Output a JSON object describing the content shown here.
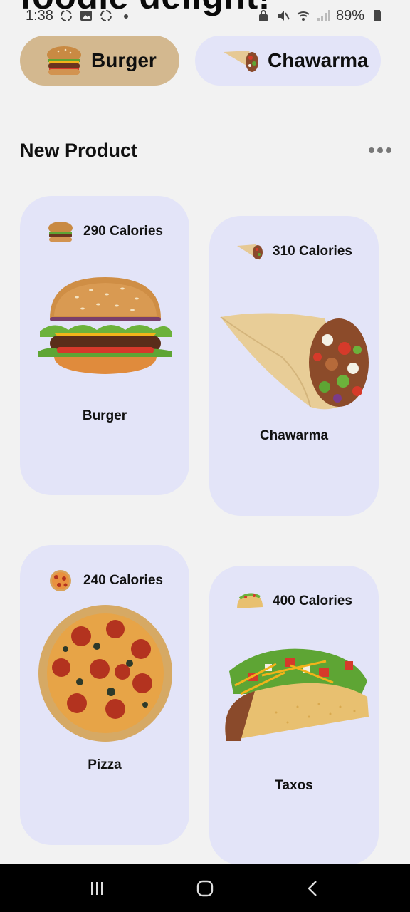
{
  "header": {
    "clipped_title": "foodie delight!"
  },
  "status_bar": {
    "time": "1:38",
    "battery": "89%",
    "left_icons": [
      "recycle-icon",
      "image-icon",
      "recycle-icon",
      "dot-icon"
    ],
    "right_icons": [
      "lock-icon",
      "mute-icon",
      "wifi-icon",
      "signal-icon",
      "battery-icon"
    ]
  },
  "categories": [
    {
      "label": "Burger",
      "icon": "burger-icon",
      "active": true,
      "color": "#d3b88f"
    },
    {
      "label": "Chawarma",
      "icon": "wrap-icon",
      "active": false,
      "color": "#e3e4f8"
    }
  ],
  "section": {
    "title": "New Product",
    "more_icon": "more-horizontal-icon"
  },
  "products": [
    {
      "name": "Burger",
      "calories": "290 Calories",
      "icon": "burger-icon"
    },
    {
      "name": "Chawarma",
      "calories": "310 Calories",
      "icon": "wrap-icon"
    },
    {
      "name": "Pizza",
      "calories": "240 Calories",
      "icon": "pizza-icon"
    },
    {
      "name": "Taxos",
      "calories": "400 Calories",
      "icon": "taco-icon"
    }
  ],
  "nav": {
    "icons": [
      "recent-apps-icon",
      "home-icon",
      "back-icon"
    ]
  },
  "colors": {
    "background": "#f2f2f2",
    "card": "#e3e4f8",
    "active_chip": "#d3b88f",
    "nav_bar": "#000000"
  }
}
